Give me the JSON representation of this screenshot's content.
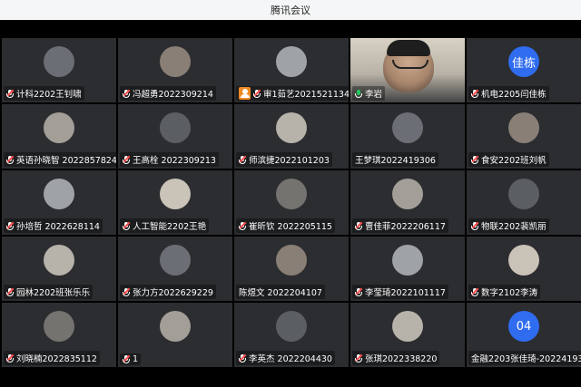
{
  "window": {
    "title": "腾讯会议"
  },
  "participants": [
    {
      "name": "计科2202王钊啸",
      "avatar": "photo",
      "mic": "muted"
    },
    {
      "name": "冯超勇2022309214",
      "avatar": "photo",
      "mic": "muted"
    },
    {
      "name": "审1茹艺2021521134",
      "avatar": "photo",
      "mic": "muted",
      "host": true
    },
    {
      "name": "李岩",
      "avatar": "video",
      "mic": "on"
    },
    {
      "name": "机电2205闫佳栋",
      "avatar": "text",
      "avatar_text": "佳栋",
      "mic": "muted"
    },
    {
      "name": "英语孙晓智 2022857824",
      "avatar": "photo",
      "mic": "muted"
    },
    {
      "name": "王高栓 2022309213",
      "avatar": "photo",
      "mic": "muted"
    },
    {
      "name": "师滨捷2022101203",
      "avatar": "photo",
      "mic": "muted"
    },
    {
      "name": "王梦琪2022419306",
      "avatar": "photo",
      "mic": "none"
    },
    {
      "name": "食安2202班刘帆",
      "avatar": "photo",
      "mic": "muted"
    },
    {
      "name": "孙培哲 2022628114",
      "avatar": "photo",
      "mic": "muted"
    },
    {
      "name": "人工智能2202王艳",
      "avatar": "photo",
      "mic": "muted"
    },
    {
      "name": "崔昕钦 2022205115",
      "avatar": "photo",
      "mic": "muted"
    },
    {
      "name": "曹佳菲2022206117",
      "avatar": "photo",
      "mic": "muted"
    },
    {
      "name": "物联2202裴凯丽",
      "avatar": "photo",
      "mic": "muted"
    },
    {
      "name": "园林2202班张乐乐",
      "avatar": "photo",
      "mic": "muted"
    },
    {
      "name": "张力方2022629229",
      "avatar": "photo",
      "mic": "muted"
    },
    {
      "name": "陈煜文 2022204107",
      "avatar": "photo",
      "mic": "none"
    },
    {
      "name": "李莹琦2022101117",
      "avatar": "photo",
      "mic": "muted"
    },
    {
      "name": "数字2102李涛",
      "avatar": "photo",
      "mic": "muted"
    },
    {
      "name": "刘晓楠2022835112",
      "avatar": "photo",
      "mic": "muted"
    },
    {
      "name": "1",
      "avatar": "photo",
      "mic": "muted"
    },
    {
      "name": "李英杰 2022204430",
      "avatar": "photo",
      "mic": "muted"
    },
    {
      "name": "张琪2022338220",
      "avatar": "photo",
      "mic": "muted"
    },
    {
      "name": "金融2203张佳琦-20224193...",
      "avatar": "text",
      "avatar_text": "04",
      "mic": "none"
    }
  ],
  "colors": {
    "tile_bg": "#2c2d30",
    "blue_avatar": "#2f6cf0",
    "host_badge": "#f08a24",
    "mic_on": "#23c55e"
  }
}
